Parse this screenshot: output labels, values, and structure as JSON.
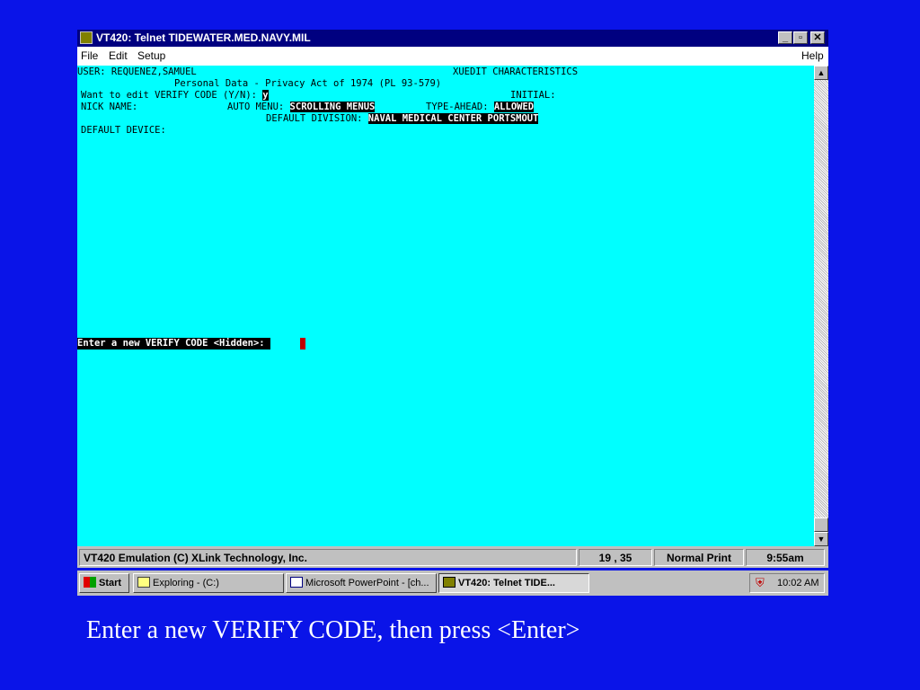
{
  "window": {
    "title": "VT420: Telnet TIDEWATER.MED.NAVY.MIL",
    "menu": {
      "file": "File",
      "edit": "Edit",
      "setup": "Setup",
      "help": "Help"
    },
    "buttons": {
      "minimize": "_",
      "maximize": "▫",
      "close": "✕"
    }
  },
  "terminal": {
    "user": "USER: REQUENEZ,SAMUEL",
    "screen_title": "XUEDIT CHARACTERISTICS",
    "privacy": "Personal Data - Privacy Act of 1974 (PL 93-579)",
    "verify_prompt": "Want to edit VERIFY CODE (Y/N): ",
    "verify_value": "y",
    "initial_label": "INITIAL:",
    "nick_name_label": "NICK NAME:",
    "auto_menu_label": "AUTO MENU: ",
    "auto_menu_value": "SCROLLING MENUS",
    "type_ahead_label": "TYPE-AHEAD: ",
    "type_ahead_value": "ALLOWED",
    "default_division_label": "DEFAULT DIVISION: ",
    "default_division_value": "NAVAL MEDICAL CENTER PORTSMOUT",
    "default_device_label": "DEFAULT DEVICE:",
    "new_verify_prompt": "Enter a new VERIFY CODE <Hidden>: "
  },
  "statusbar": {
    "emulation": "VT420 Emulation (C) XLink Technology, Inc.",
    "cursor_pos": "19 , 35",
    "print_mode": "Normal Print",
    "time": "9:55am"
  },
  "taskbar": {
    "start": "Start",
    "items": [
      "Exploring - (C:)",
      "Microsoft PowerPoint - [ch...",
      "VT420: Telnet TIDE..."
    ],
    "clock": "10:02 AM"
  },
  "caption": "Enter a new VERIFY CODE, then press <Enter>"
}
